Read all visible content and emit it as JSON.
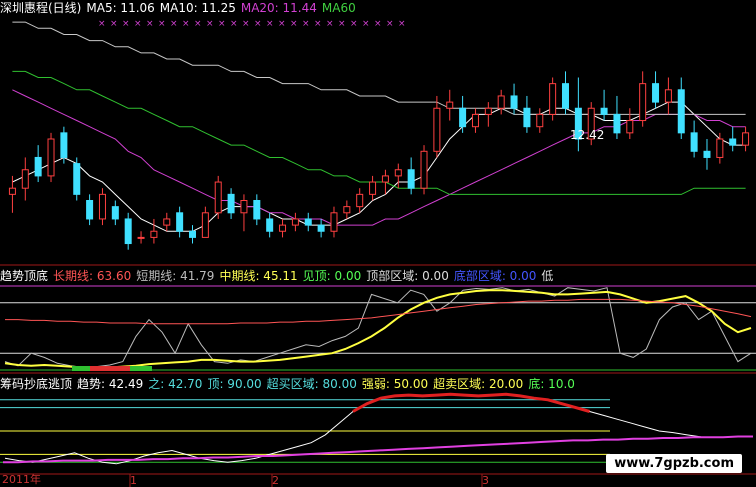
{
  "header": {
    "title": "深圳惠程(日线)",
    "ma": [
      {
        "label": "MA5:",
        "value": "11.06",
        "color": "#ffffff"
      },
      {
        "label": "MA10:",
        "value": "11.25",
        "color": "#ffffff"
      },
      {
        "label": "MA20:",
        "value": "11.44",
        "color": "#d040d0"
      },
      {
        "label": "MA60",
        "value": "",
        "color": "#40d040"
      }
    ]
  },
  "indicator1": {
    "name": "趋势顶底",
    "items": [
      {
        "label": "长期线:",
        "value": "63.60",
        "color": "#ff5555"
      },
      {
        "label": "短期线:",
        "value": "41.79",
        "color": "#bbbbbb"
      },
      {
        "label": "中期线:",
        "value": "45.11",
        "color": "#ffff55"
      },
      {
        "label": "见顶:",
        "value": "0.00",
        "color": "#55ff55"
      },
      {
        "label": "顶部区域:",
        "value": "0.00",
        "color": "#dddddd"
      },
      {
        "label": "底部区域:",
        "value": "0.00",
        "color": "#4455ff"
      },
      {
        "label": "低",
        "value": "",
        "color": "#dddddd"
      }
    ]
  },
  "indicator2": {
    "name": "筹码抄底逃顶",
    "items": [
      {
        "label": "趋势:",
        "value": "42.49",
        "color": "#ffffff"
      },
      {
        "label": "之:",
        "value": "42.70",
        "color": "#55dddd"
      },
      {
        "label": "顶:",
        "value": "90.00",
        "color": "#55dddd"
      },
      {
        "label": "超买区域:",
        "value": "80.00",
        "color": "#55dddd"
      },
      {
        "label": "强弱:",
        "value": "50.00",
        "color": "#ffff55"
      },
      {
        "label": "超卖区域:",
        "value": "20.00",
        "color": "#ffff55"
      },
      {
        "label": "底:",
        "value": "10.0",
        "color": "#55ff55"
      }
    ]
  },
  "price_label": "12.42",
  "watermark": "www.7gpzb.com",
  "dates": [
    "2011年",
    "1",
    "2",
    "3"
  ],
  "chart_data": [
    {
      "type": "candlestick",
      "title": "深圳惠程(日线)",
      "ylim": [
        9.5,
        13.5
      ],
      "candles": [
        [
          10.6,
          10.9,
          10.3,
          10.7
        ],
        [
          10.7,
          11.2,
          10.5,
          11.0
        ],
        [
          11.2,
          11.4,
          10.8,
          10.9
        ],
        [
          10.9,
          11.6,
          10.8,
          11.5
        ],
        [
          11.6,
          11.7,
          11.1,
          11.2
        ],
        [
          11.1,
          11.2,
          10.5,
          10.6
        ],
        [
          10.5,
          10.6,
          10.1,
          10.2
        ],
        [
          10.2,
          10.7,
          10.1,
          10.6
        ],
        [
          10.4,
          10.5,
          10.1,
          10.2
        ],
        [
          10.2,
          10.3,
          9.7,
          9.8
        ],
        [
          9.9,
          10.0,
          9.8,
          9.9
        ],
        [
          9.9,
          10.2,
          9.8,
          10.0
        ],
        [
          10.1,
          10.3,
          10.0,
          10.2
        ],
        [
          10.3,
          10.4,
          9.9,
          10.0
        ],
        [
          10.0,
          10.1,
          9.8,
          9.9
        ],
        [
          9.9,
          10.4,
          9.9,
          10.3
        ],
        [
          10.3,
          10.9,
          10.2,
          10.8
        ],
        [
          10.6,
          10.7,
          10.2,
          10.3
        ],
        [
          10.3,
          10.6,
          10.0,
          10.5
        ],
        [
          10.5,
          10.6,
          10.1,
          10.2
        ],
        [
          10.2,
          10.3,
          9.9,
          10.0
        ],
        [
          10.0,
          10.2,
          9.9,
          10.1
        ],
        [
          10.1,
          10.3,
          10.0,
          10.2
        ],
        [
          10.2,
          10.3,
          10.0,
          10.1
        ],
        [
          10.1,
          10.2,
          9.9,
          10.0
        ],
        [
          10.0,
          10.4,
          9.9,
          10.3
        ],
        [
          10.3,
          10.5,
          10.2,
          10.4
        ],
        [
          10.4,
          10.7,
          10.3,
          10.6
        ],
        [
          10.6,
          10.9,
          10.5,
          10.8
        ],
        [
          10.8,
          11.0,
          10.6,
          10.9
        ],
        [
          10.9,
          11.1,
          10.7,
          11.0
        ],
        [
          11.0,
          11.2,
          10.6,
          10.7
        ],
        [
          10.7,
          11.4,
          10.6,
          11.3
        ],
        [
          11.3,
          12.2,
          11.2,
          12.0
        ],
        [
          12.0,
          12.3,
          11.8,
          12.1
        ],
        [
          12.0,
          12.2,
          11.6,
          11.7
        ],
        [
          11.7,
          12.0,
          11.6,
          11.9
        ],
        [
          11.9,
          12.1,
          11.7,
          12.0
        ],
        [
          12.0,
          12.3,
          11.9,
          12.2
        ],
        [
          12.2,
          12.4,
          11.9,
          12.0
        ],
        [
          12.0,
          12.2,
          11.6,
          11.7
        ],
        [
          11.7,
          12.0,
          11.6,
          11.9
        ],
        [
          11.9,
          12.5,
          11.8,
          12.4
        ],
        [
          12.4,
          12.6,
          11.9,
          12.0
        ],
        [
          12.0,
          12.5,
          11.3,
          11.5
        ],
        [
          11.5,
          12.1,
          11.4,
          12.0
        ],
        [
          12.0,
          12.3,
          11.8,
          11.9
        ],
        [
          11.9,
          12.2,
          11.5,
          11.6
        ],
        [
          11.6,
          12.0,
          11.5,
          11.8
        ],
        [
          11.8,
          12.6,
          11.7,
          12.4
        ],
        [
          12.4,
          12.6,
          12.0,
          12.1
        ],
        [
          12.1,
          12.5,
          11.9,
          12.3
        ],
        [
          12.3,
          12.5,
          11.5,
          11.6
        ],
        [
          11.6,
          11.8,
          11.2,
          11.3
        ],
        [
          11.3,
          11.5,
          11.0,
          11.2
        ],
        [
          11.2,
          11.6,
          11.1,
          11.5
        ],
        [
          11.5,
          11.7,
          11.3,
          11.4
        ],
        [
          11.4,
          11.7,
          11.3,
          11.6
        ]
      ],
      "ma_series": [
        {
          "name": "MA5",
          "values": [
            10.8,
            10.9,
            11.0,
            11.1,
            11.2,
            11.1,
            10.9,
            10.8,
            10.6,
            10.4,
            10.2,
            10.1,
            10.0,
            10.0,
            10.0,
            10.1,
            10.3,
            10.4,
            10.4,
            10.4,
            10.3,
            10.2,
            10.2,
            10.1,
            10.1,
            10.1,
            10.2,
            10.3,
            10.5,
            10.6,
            10.8,
            10.8,
            10.9,
            11.2,
            11.5,
            11.7,
            11.9,
            11.9,
            12.0,
            12.0,
            11.9,
            11.9,
            12.0,
            12.0,
            11.9,
            11.9,
            11.8,
            11.8,
            11.8,
            11.9,
            12.0,
            12.1,
            12.1,
            11.9,
            11.7,
            11.5,
            11.4,
            11.4
          ]
        },
        {
          "name": "MA20",
          "values": [
            12.3,
            12.2,
            12.1,
            12.0,
            11.9,
            11.8,
            11.7,
            11.6,
            11.5,
            11.3,
            11.2,
            11.0,
            10.9,
            10.8,
            10.7,
            10.6,
            10.5,
            10.5,
            10.4,
            10.4,
            10.3,
            10.3,
            10.2,
            10.2,
            10.2,
            10.1,
            10.1,
            10.1,
            10.1,
            10.2,
            10.2,
            10.3,
            10.4,
            10.5,
            10.6,
            10.7,
            10.8,
            10.9,
            11.0,
            11.1,
            11.2,
            11.3,
            11.4,
            11.5,
            11.6,
            11.6,
            11.7,
            11.7,
            11.8,
            11.8,
            11.9,
            11.9,
            11.9,
            11.9,
            11.8,
            11.8,
            11.7,
            11.7
          ]
        },
        {
          "name": "MA60",
          "values": [
            12.6,
            12.6,
            12.5,
            12.5,
            12.4,
            12.3,
            12.3,
            12.2,
            12.1,
            12.0,
            12.0,
            11.9,
            11.8,
            11.7,
            11.7,
            11.6,
            11.5,
            11.4,
            11.4,
            11.3,
            11.2,
            11.2,
            11.1,
            11.0,
            11.0,
            10.9,
            10.9,
            10.8,
            10.8,
            10.8,
            10.7,
            10.7,
            10.7,
            10.7,
            10.6,
            10.6,
            10.6,
            10.6,
            10.6,
            10.6,
            10.6,
            10.6,
            10.6,
            10.6,
            10.6,
            10.6,
            10.6,
            10.6,
            10.6,
            10.6,
            10.6,
            10.6,
            10.6,
            10.7,
            10.7,
            10.7,
            10.7,
            10.7
          ]
        },
        {
          "name": "MA120",
          "values": [
            13.4,
            13.4,
            13.3,
            13.3,
            13.2,
            13.2,
            13.1,
            13.1,
            13.0,
            13.0,
            12.9,
            12.9,
            12.8,
            12.8,
            12.7,
            12.7,
            12.7,
            12.6,
            12.6,
            12.5,
            12.5,
            12.4,
            12.4,
            12.4,
            12.3,
            12.3,
            12.3,
            12.2,
            12.2,
            12.2,
            12.1,
            12.1,
            12.1,
            12.1,
            12.0,
            12.0,
            12.0,
            12.0,
            12.0,
            11.9,
            11.9,
            11.9,
            11.9,
            11.9,
            11.9,
            11.9,
            11.9,
            11.9,
            11.9,
            11.9,
            11.9,
            11.9,
            11.9,
            11.9,
            11.9,
            11.9,
            11.9,
            11.9
          ]
        }
      ]
    },
    {
      "type": "line",
      "title": "趋势顶底",
      "ylim": [
        0,
        100
      ],
      "series": [
        {
          "name": "短期线",
          "values": [
            10,
            5,
            20,
            15,
            8,
            5,
            3,
            4,
            6,
            10,
            40,
            60,
            45,
            20,
            55,
            30,
            10,
            8,
            12,
            10,
            15,
            20,
            25,
            30,
            28,
            35,
            40,
            50,
            90,
            85,
            80,
            95,
            90,
            70,
            80,
            95,
            97,
            96,
            98,
            94,
            96,
            92,
            88,
            98,
            96,
            94,
            98,
            20,
            15,
            25,
            60,
            75,
            80,
            60,
            70,
            40,
            10,
            20
          ]
        },
        {
          "name": "中期线",
          "values": [
            8,
            6,
            5,
            6,
            5,
            4,
            3,
            3,
            3,
            4,
            5,
            7,
            8,
            9,
            10,
            12,
            12,
            11,
            10,
            10,
            11,
            12,
            14,
            16,
            18,
            20,
            25,
            32,
            40,
            50,
            62,
            72,
            80,
            86,
            90,
            92,
            94,
            95,
            95,
            94,
            93,
            92,
            90,
            90,
            91,
            92,
            93,
            90,
            85,
            80,
            82,
            85,
            88,
            80,
            70,
            55,
            45,
            50
          ]
        },
        {
          "name": "长期线",
          "values": [
            60,
            60,
            59,
            59,
            58,
            58,
            57,
            57,
            56,
            56,
            56,
            55,
            55,
            55,
            55,
            55,
            55,
            55,
            56,
            56,
            56,
            57,
            57,
            58,
            58,
            59,
            60,
            61,
            62,
            64,
            66,
            68,
            70,
            72,
            74,
            76,
            78,
            79,
            80,
            81,
            82,
            82,
            83,
            83,
            84,
            84,
            84,
            84,
            83,
            82,
            81,
            80,
            78,
            76,
            73,
            70,
            67,
            63.6
          ]
        }
      ],
      "levels": [
        0,
        20,
        80,
        100
      ]
    },
    {
      "type": "line",
      "title": "筹码抄底逃顶",
      "ylim": [
        0,
        100
      ],
      "series": [
        {
          "name": "趋势",
          "values": [
            15,
            12,
            10,
            14,
            18,
            22,
            15,
            10,
            8,
            12,
            18,
            22,
            25,
            20,
            15,
            12,
            10,
            12,
            15,
            20,
            25,
            30,
            35,
            45,
            60,
            75,
            85,
            92,
            95,
            96,
            95,
            96,
            97,
            96,
            95,
            96,
            97,
            95,
            92,
            90,
            85,
            80,
            75,
            70,
            65,
            60,
            55,
            50,
            48,
            45,
            42.49
          ]
        },
        {
          "name": "强弱",
          "values": [
            10,
            10,
            11,
            11,
            12,
            12,
            12,
            13,
            13,
            13,
            14,
            14,
            15,
            15,
            16,
            16,
            17,
            18,
            18,
            19,
            20,
            21,
            22,
            23,
            24,
            25,
            26,
            27,
            28,
            29,
            30,
            31,
            32,
            33,
            34,
            35,
            36,
            37,
            38,
            38,
            39,
            39,
            40,
            40,
            41,
            41,
            42,
            42,
            42,
            43,
            43
          ]
        }
      ],
      "levels": [
        10,
        20,
        50,
        80,
        90
      ]
    }
  ]
}
